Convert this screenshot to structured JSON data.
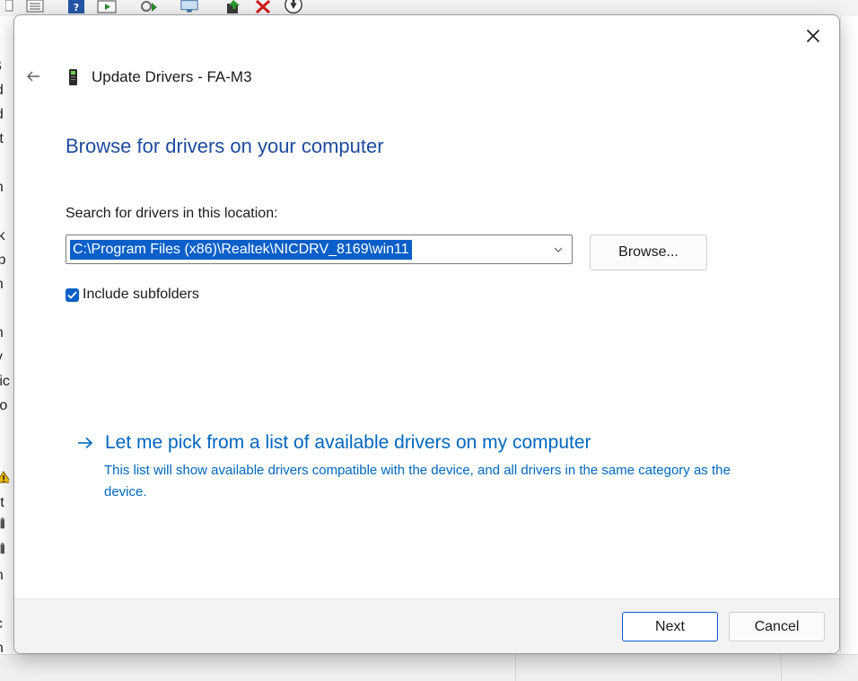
{
  "background": {
    "tree_fragments": [
      "-B",
      "ud",
      "ud",
      "att",
      "lu",
      "an",
      "or",
      "isk",
      "isp",
      "irn",
      "ur",
      "un",
      "ey",
      "Mic",
      "Mo",
      "et",
      "th",
      "",
      "ort",
      "",
      "",
      "rin",
      "ro",
      "ec",
      "en"
    ],
    "toolbar_icons": [
      "properties-icon",
      "help-icon",
      "action-icon",
      "scan-hardware-icon",
      "monitor-icon",
      "update-driver-icon",
      "uninstall-icon",
      "download-icon"
    ]
  },
  "dialog": {
    "title": "Update Drivers - FA-M3",
    "heading": "Browse for drivers on your computer",
    "search_label": "Search for drivers in this location:",
    "path_value": "C:\\Program Files (x86)\\Realtek\\NICDRV_8169\\win11",
    "browse_label": "Browse...",
    "include_subfolders_label": "Include subfolders",
    "include_subfolders_checked": true,
    "pick_title": "Let me pick from a list of available drivers on my computer",
    "pick_description": "This list will show available drivers compatible with the device, and all drivers in the same category as the device.",
    "next_label": "Next",
    "cancel_label": "Cancel"
  },
  "colors": {
    "heading": "#1e4b9e",
    "link": "#0067c0",
    "accent": "#0a5fc8"
  }
}
